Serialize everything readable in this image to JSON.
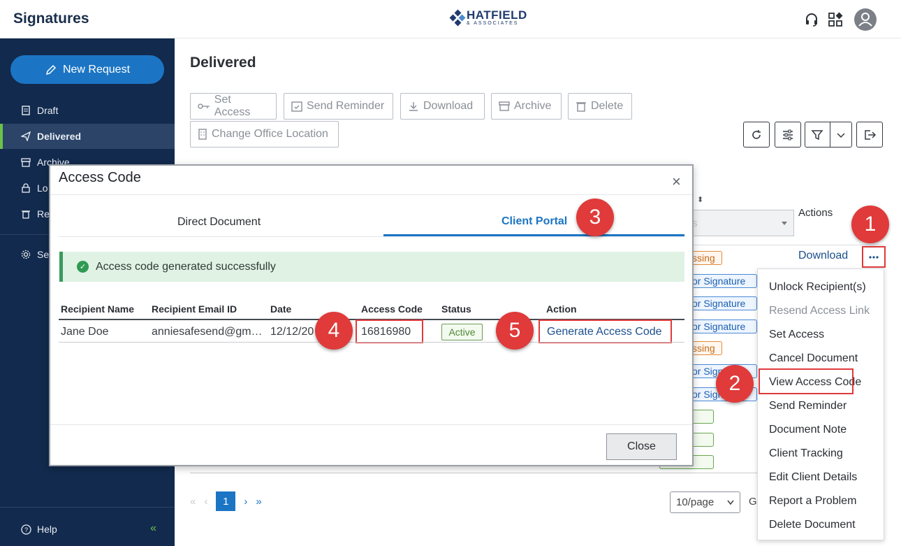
{
  "header": {
    "app_title": "Signatures",
    "logo_brand": "HATFIELD",
    "logo_sub": "& ASSOCIATES"
  },
  "sidebar": {
    "new_request_label": "New Request",
    "items": [
      {
        "label": "Draft",
        "icon": "document-icon"
      },
      {
        "label": "Delivered",
        "icon": "send-icon"
      },
      {
        "label": "Archive",
        "icon": "archive-icon"
      },
      {
        "label": "Lo",
        "icon": "lock-icon"
      },
      {
        "label": "Re",
        "icon": "trash-icon"
      },
      {
        "label": "Se",
        "icon": "gear-icon"
      }
    ],
    "help_label": "Help"
  },
  "main": {
    "title": "Delivered",
    "toolbar": {
      "set_access": "Set Access",
      "send_reminder": "Send Reminder",
      "download": "Download",
      "archive": "Archive",
      "delete": "Delete",
      "change_office": "Change Office Location"
    },
    "table_bg": {
      "actions_header": "Actions",
      "select_value": "s",
      "row_download": "Download",
      "badges": [
        "ssing",
        "or Signature",
        "or Signature",
        "or Signature",
        "ssing",
        "or Signature",
        "or Signature",
        "ned",
        "ned",
        "ned"
      ]
    },
    "pagination": {
      "current_page": "1",
      "per_page": "10/page",
      "go_label": "G"
    }
  },
  "context_menu": {
    "items": [
      "Unlock Recipient(s)",
      "Resend Access Link",
      "Set Access",
      "Cancel Document",
      "View Access Code",
      "Send Reminder",
      "Document Note",
      "Client Tracking",
      "Edit Client Details",
      "Report a Problem",
      "Delete Document"
    ]
  },
  "dialog": {
    "title": "Access Code",
    "tabs": [
      "Direct Document",
      "Client Portal"
    ],
    "alert": "Access code generated successfully",
    "columns": [
      "Recipient Name",
      "Recipient Email ID",
      "Date",
      "Access Code",
      "Status",
      "Action"
    ],
    "row": {
      "name": "Jane Doe",
      "email": "anniesafesend@gm…",
      "date": "12/12/20",
      "code": "16816980",
      "status": "Active",
      "action": "Generate Access Code"
    },
    "close_label": "Close"
  },
  "callouts": [
    "1",
    "2",
    "3",
    "4",
    "5"
  ],
  "colors": {
    "sidebar_bg": "#122a4d",
    "accent_blue": "#1b75c4",
    "callout_red": "#e03a3a",
    "success_green": "#dff2e4"
  }
}
